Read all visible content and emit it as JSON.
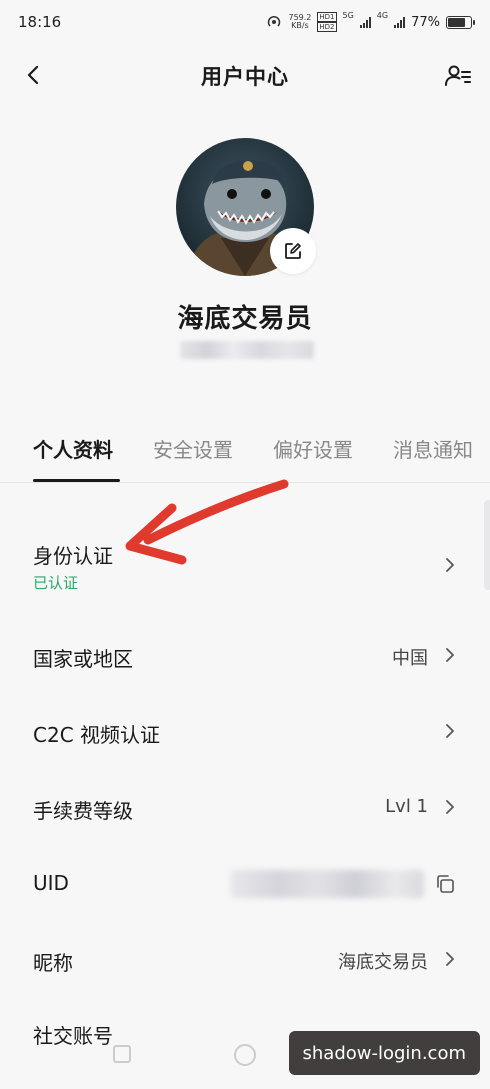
{
  "status_bar": {
    "time": "18:16",
    "net_speed": "759.2",
    "net_unit": "KB/s",
    "sim1_tag": "HD1",
    "sim2_tag": "HD2",
    "net1": "5G",
    "net2": "4G",
    "battery": "77%"
  },
  "header": {
    "title": "用户中心",
    "back_icon": "chevron-left-icon",
    "profile_switch_icon": "user-list-icon"
  },
  "profile": {
    "nickname": "海底交易员",
    "edit_icon": "edit-icon"
  },
  "tabs": [
    {
      "label": "个人资料",
      "active": true
    },
    {
      "label": "安全设置",
      "active": false
    },
    {
      "label": "偏好设置",
      "active": false
    },
    {
      "label": "消息通知",
      "active": false
    }
  ],
  "rows": {
    "identity": {
      "label": "身份认证",
      "status": "已认证"
    },
    "region": {
      "label": "国家或地区",
      "value": "中国"
    },
    "c2c_video": {
      "label": "C2C 视频认证"
    },
    "fee_level": {
      "label": "手续费等级",
      "value": "Lvl 1"
    },
    "uid": {
      "label": "UID"
    },
    "nickname": {
      "label": "昵称",
      "value": "海底交易员"
    },
    "social": {
      "label": "社交账号"
    }
  },
  "colors": {
    "accent_green": "#2aa86a",
    "arrow_red": "#e03a2f"
  },
  "watermark": "shadow-login.com"
}
